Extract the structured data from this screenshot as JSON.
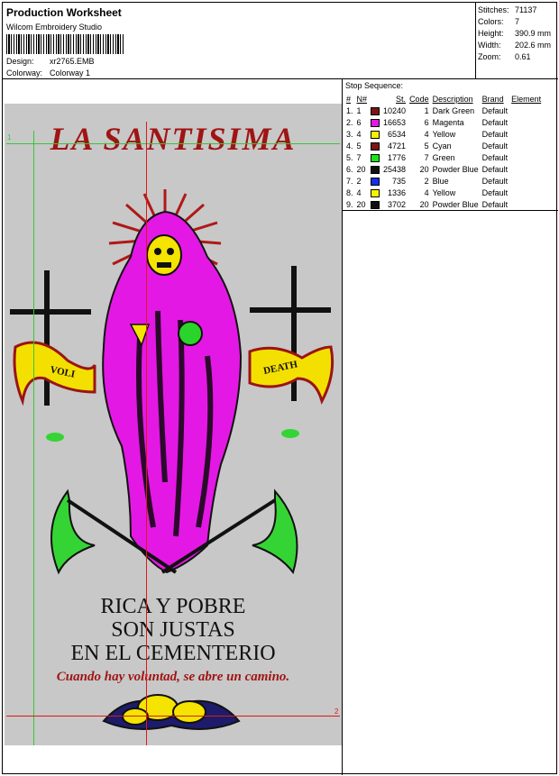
{
  "header": {
    "title": "Production Worksheet",
    "software": "Wilcom Embroidery Studio",
    "design_label": "Design:",
    "design_value": "xr2765.EMB",
    "colorway_label": "Colorway:",
    "colorway_value": "Colorway 1"
  },
  "stats": [
    {
      "label": "Stitches:",
      "value": "71137"
    },
    {
      "label": "Colors:",
      "value": "7"
    },
    {
      "label": "Height:",
      "value": "390.9 mm"
    },
    {
      "label": "Width:",
      "value": "202.6 mm"
    },
    {
      "label": "Zoom:",
      "value": "0.61"
    }
  ],
  "sequence": {
    "title": "Stop Sequence:",
    "columns": [
      "#",
      "N#",
      "St.",
      "Code",
      "Description",
      "Brand",
      "Element"
    ],
    "rows": [
      {
        "idx": "1.",
        "n": "1",
        "color": "#7a1616",
        "st": "10240",
        "code": "1",
        "desc": "Dark Green",
        "brand": "Default"
      },
      {
        "idx": "2.",
        "n": "6",
        "color": "#e418e4",
        "st": "16653",
        "code": "6",
        "desc": "Magenta",
        "brand": "Default"
      },
      {
        "idx": "3.",
        "n": "4",
        "color": "#f4f400",
        "st": "6534",
        "code": "4",
        "desc": "Yellow",
        "brand": "Default"
      },
      {
        "idx": "4.",
        "n": "5",
        "color": "#7a1616",
        "st": "4721",
        "code": "5",
        "desc": "Cyan",
        "brand": "Default"
      },
      {
        "idx": "5.",
        "n": "7",
        "color": "#18e418",
        "st": "1776",
        "code": "7",
        "desc": "Green",
        "brand": "Default"
      },
      {
        "idx": "6.",
        "n": "20",
        "color": "#101010",
        "st": "25438",
        "code": "20",
        "desc": "Powder Blue",
        "brand": "Default"
      },
      {
        "idx": "7.",
        "n": "2",
        "color": "#1430e8",
        "st": "735",
        "code": "2",
        "desc": "Blue",
        "brand": "Default"
      },
      {
        "idx": "8.",
        "n": "4",
        "color": "#f4f400",
        "st": "1336",
        "code": "4",
        "desc": "Yellow",
        "brand": "Default"
      },
      {
        "idx": "9.",
        "n": "20",
        "color": "#101010",
        "st": "3702",
        "code": "20",
        "desc": "Powder Blue",
        "brand": "Default"
      }
    ]
  },
  "design": {
    "heading": "LA SANTISIMA",
    "banner_left": "VOLI",
    "banner_right": "DEATH",
    "line1": "RICA Y POBRE",
    "line2": "SON JUSTAS",
    "line3": "EN EL CEMENTERIO",
    "motto": "Cuando hay voluntad, se abre un camino.",
    "marker_1": "1",
    "marker_2": "2"
  }
}
